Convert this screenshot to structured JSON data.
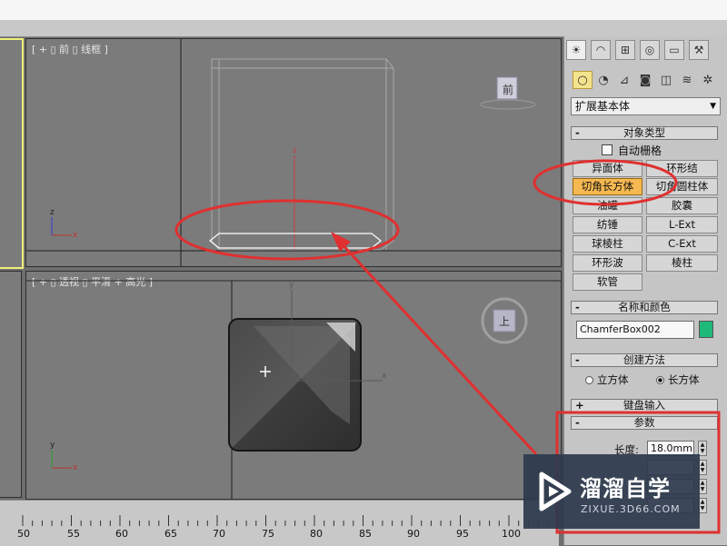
{
  "viewports": {
    "front": {
      "label": "[ + ▯ 前 ▯ 线框 ]",
      "cube_label": "前"
    },
    "perspective": {
      "label": "[ + ▯ 透视 ▯ 平滑 + 高光 ]",
      "cube_label": "上"
    }
  },
  "axes": {
    "x": "x",
    "y": "y",
    "z": "z"
  },
  "command_panel": {
    "tab_icons": [
      "sun-icon",
      "arc-icon",
      "hierarchy-icon",
      "motion-icon",
      "display-icon",
      "hammer-icon"
    ],
    "sub_icons": [
      "sphere-icon",
      "shapes-icon",
      "light-icon",
      "camera-icon",
      "helper-icon",
      "spacewarp-icon",
      "systems-icon"
    ],
    "category_dropdown": {
      "value": "扩展基本体",
      "arrow": "▼"
    },
    "object_type": {
      "title": "对象类型",
      "autogrid_label": "自动栅格",
      "buttons": [
        "异面体",
        "环形结",
        "切角长方体",
        "切角圆柱体",
        "油罐",
        "胶囊",
        "纺锤",
        "L-Ext",
        "球棱柱",
        "C-Ext",
        "环形波",
        "棱柱",
        "软管"
      ]
    },
    "name_color": {
      "title": "名称和颜色",
      "name_value": "ChamferBox002",
      "swatch_color": "#1fb97a"
    },
    "creation_method": {
      "title": "创建方法",
      "option_cube": "立方体",
      "option_box": "长方体",
      "selected": "长方体"
    },
    "keyboard_entry": {
      "title": "键盘输入"
    },
    "parameters": {
      "title": "参数",
      "length_label": "长度:",
      "length_value": "18.0mm"
    },
    "rollout_sign_minus": "-",
    "rollout_sign_plus": "+"
  },
  "ruler": {
    "ticks": [
      "50",
      "55",
      "60",
      "65",
      "70",
      "75",
      "80",
      "85",
      "90",
      "95",
      "100"
    ]
  },
  "watermark": {
    "brand": "溜溜自学",
    "url": "ZIXUE.3D66.COM"
  },
  "colors": {
    "highlight_orange": "#f6b850",
    "annotation_red": "#e03030",
    "selection_yellow": "#f0f07a"
  }
}
